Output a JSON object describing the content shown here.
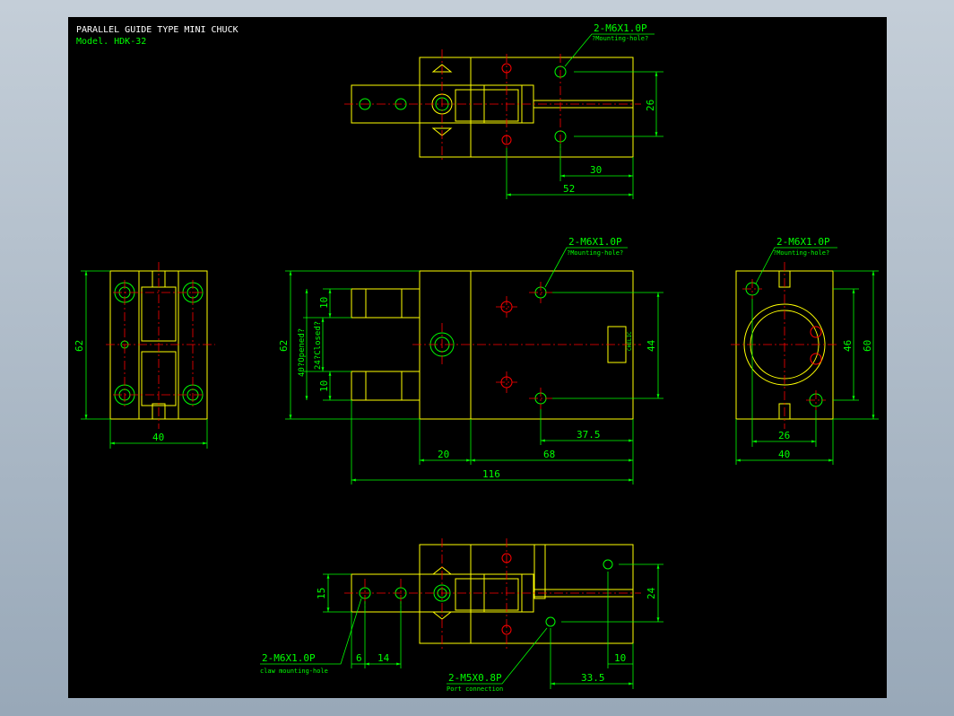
{
  "title": {
    "main": "PARALLEL GUIDE TYPE MINI CHUCK",
    "model": "Model. HDK-32"
  },
  "colors": {
    "background": "#000000",
    "outline": "#ffff00",
    "dimension": "#00ff00",
    "centerline": "#ff0000",
    "hole": "#ff0000",
    "title_text": "#ffffff"
  },
  "top_view": {
    "callout": "2-M6X1.0P",
    "callout_note": "?Mounting-hole?",
    "dim_height": "26",
    "dim_30": "30",
    "dim_52": "52"
  },
  "front_view": {
    "callout": "2-M6X1.0P",
    "callout_note": "?Mounting-hole?",
    "dim_62": "62",
    "dim_opened": "40?Opened?",
    "dim_closed": "24?Closed?",
    "dim_jaw_top": "10",
    "dim_jaw_bottom": "10",
    "dim_44": "44",
    "dim_37_5": "37.5",
    "dim_20": "20",
    "dim_68": "68",
    "dim_116": "116",
    "nameplate": "CHELIC"
  },
  "left_view": {
    "dim_62": "62",
    "dim_40": "40"
  },
  "right_view": {
    "callout": "2-M6X1.0P",
    "callout_note": "?Mounting-hole?",
    "dim_46": "46",
    "dim_60": "60",
    "dim_26": "26",
    "dim_40": "40"
  },
  "bottom_view": {
    "dim_15": "15",
    "dim_24": "24",
    "dim_6": "6",
    "dim_14": "14",
    "dim_10": "10",
    "dim_33_5": "33.5",
    "claw_callout": "2-M6X1.0P",
    "claw_note": "claw mounting-hole",
    "port_callout": "2-M5X0.8P",
    "port_note": "Port connection"
  }
}
